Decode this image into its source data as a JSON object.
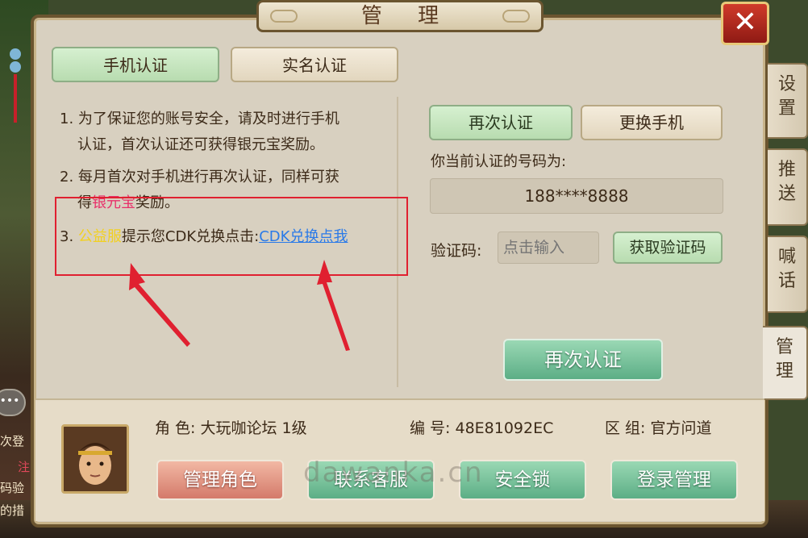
{
  "panel": {
    "title": "管 理",
    "close_label": "✕"
  },
  "tabs": {
    "phone": "手机认证",
    "realname": "实名认证"
  },
  "rules": {
    "r1_num": "1.",
    "r1_line1": "为了保证您的账号安全，请及时进行手机",
    "r1_line2": "认证，首次认证还可获得银元宝奖励。",
    "r2_num": "2.",
    "r2_line1": "每月首次对手机进行再次认证，同样可获",
    "r2_line2a": "得",
    "r2_line2_highlight": "银元宝",
    "r2_line2b": "奖励。",
    "r3_num": "3.",
    "r3_highlight": "公益服",
    "r3_text": "提示您CDK兑换点击:",
    "r3_link": "CDK兑换点我"
  },
  "auth": {
    "reauth_small": "再次认证",
    "change_phone": "更换手机",
    "phone_label": "你当前认证的号码为:",
    "phone_number": "188****8888",
    "code_label": "验证码:",
    "code_placeholder": "点击输入",
    "get_code": "获取验证码",
    "reauth_big": "再次认证"
  },
  "side_tabs": {
    "settings": "设\n置",
    "push": "推\n送",
    "shout": "喊\n话",
    "manage": "管\n理"
  },
  "character": {
    "role": "角 色: 大玩咖论坛 1级",
    "id": "编 号: 48E81092EC",
    "zone": "区 组: 官方问道"
  },
  "bottom_buttons": {
    "manage_role": "管理角色",
    "contact": "联系客服",
    "lock": "安全锁",
    "login_manage": "登录管理"
  },
  "watermark": "dawanka.cn",
  "side_fragments": {
    "f1": "次登",
    "f2": "注",
    "f3": "码验",
    "f4": "的措"
  },
  "colors": {
    "highlight_pink": "#e8306a",
    "highlight_yellow": "#f2d020",
    "link_blue": "#2a7ae8",
    "annotation_red": "#e02030"
  }
}
